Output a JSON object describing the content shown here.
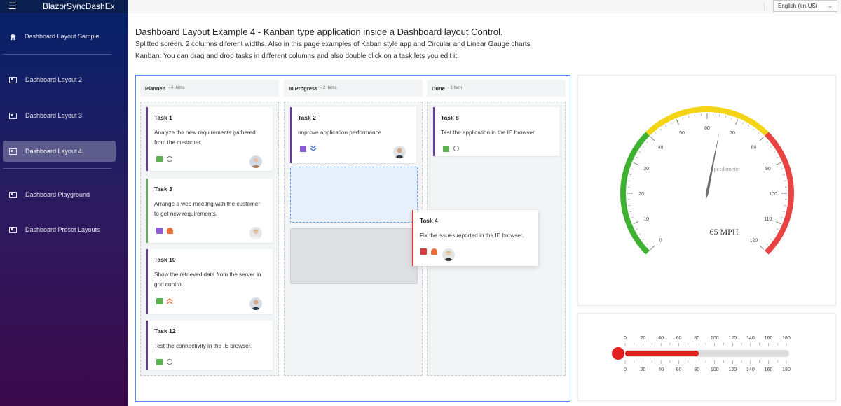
{
  "app": {
    "brand": "BlazorSyncDashEx"
  },
  "sidebar": {
    "items": [
      {
        "label": "Dashboard Layout Sample"
      },
      {
        "label": "Dashboard Layout 2"
      },
      {
        "label": "Dashboard Layout 3"
      },
      {
        "label": "Dashboard Layout 4"
      },
      {
        "label": "Dashboard Playground"
      },
      {
        "label": "Dashboard Preset Layouts"
      }
    ]
  },
  "topbar": {
    "language": "English (en-US)"
  },
  "header": {
    "title": "Dashboard Layout Example 4 - Kanban type application inside a Dashboard layout Control.",
    "line1": "Splitted screen. 2 columns diferent widths. Also in this page examples of Kaban style app and Circular and Linear Gauge charts",
    "line2": "Kanban: You can drag and drop tasks in different columns and also double click on a task lets you edit it."
  },
  "kanban": {
    "columns": [
      {
        "name": "Planned",
        "count": "- 4 Items"
      },
      {
        "name": "In Progress",
        "count": "- 2 Items"
      },
      {
        "name": "Done",
        "count": "- 1 Item"
      }
    ],
    "cards": {
      "task1": {
        "title": "Task 1",
        "text": "Analyze the new requirements gathered from the customer."
      },
      "task3": {
        "title": "Task 3",
        "text": "Arrange a web meeting with the customer to get new requirements."
      },
      "task10": {
        "title": "Task 10",
        "text": "Show the retrieved data from the server in grid control."
      },
      "task12": {
        "title": "Task 12",
        "text": "Test the connectivity in the IE browser."
      },
      "task2": {
        "title": "Task 2",
        "text": "Improve application performance"
      },
      "task8": {
        "title": "Task 8",
        "text": "Test the application in the IE browser."
      },
      "task4": {
        "title": "Task 4",
        "text": "Fix the issues reported in the IE browser."
      }
    },
    "colors": {
      "purple": "#6a38a3",
      "green": "#5bb04f",
      "red": "#d8393b",
      "orange": "#e8703a",
      "blue": "#3d6fd9"
    }
  },
  "gauge": {
    "label": "Speedometer",
    "value_text": "65 MPH",
    "value": 65,
    "min": 0,
    "max": 120,
    "ticks": [
      "0",
      "10",
      "20",
      "30",
      "40",
      "50",
      "60",
      "70",
      "80",
      "90",
      "100",
      "110",
      "120"
    ],
    "ranges": [
      {
        "from": 0,
        "to": 40,
        "color": "#3fb131"
      },
      {
        "from": 40,
        "to": 80,
        "color": "#f5d415"
      },
      {
        "from": 80,
        "to": 120,
        "color": "#e84343"
      }
    ]
  },
  "linear": {
    "min": 0,
    "max": 180,
    "value": 90,
    "ticks": [
      "0",
      "20",
      "40",
      "60",
      "80",
      "100",
      "120",
      "140",
      "160",
      "180"
    ],
    "bar_color": "#e01e1e"
  }
}
